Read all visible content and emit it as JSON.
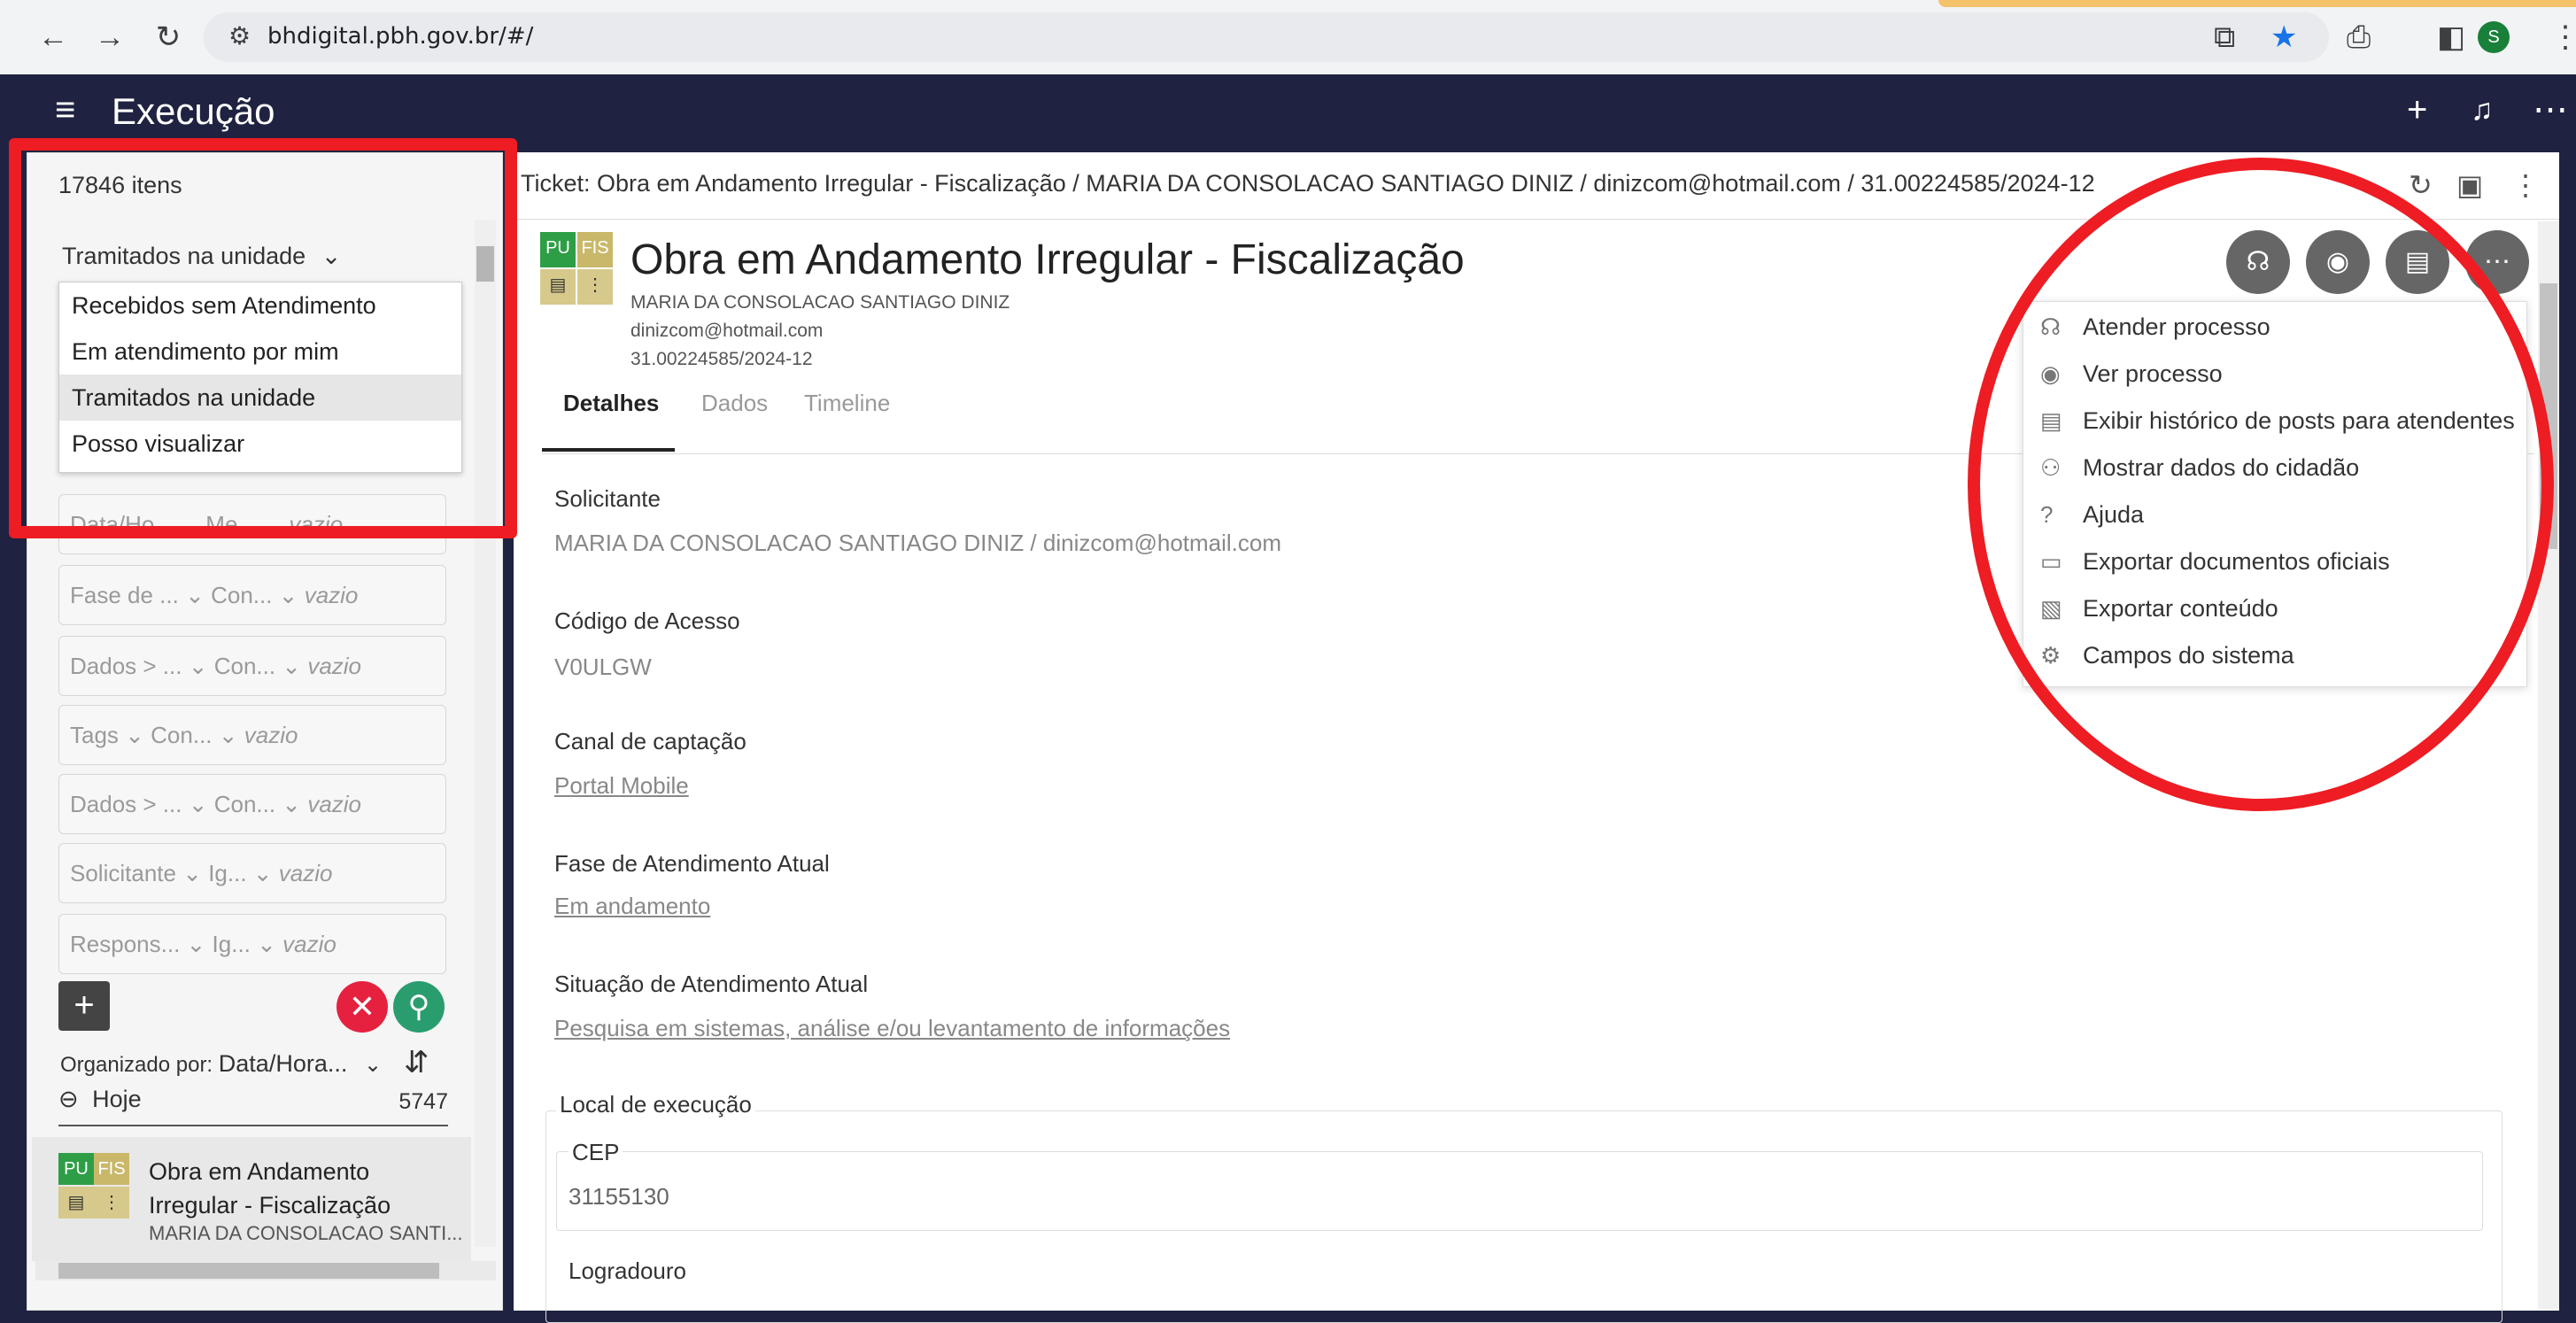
{
  "browser": {
    "url": "bhdigital.pbh.gov.br/#/",
    "profile_initial": "S"
  },
  "app": {
    "title": "Execução"
  },
  "left": {
    "items_count": "17846 itens",
    "filter_selected": "Tramitados na unidade",
    "dropdown_options": [
      "Recebidos sem Atendimento",
      "Em atendimento por mim",
      "Tramitados na unidade",
      "Posso visualizar"
    ],
    "filter_rows": [
      {
        "field": "Data/Ho...",
        "op": "Me...",
        "value": "vazio"
      },
      {
        "field": "Fase de ...",
        "op": "Con...",
        "value": "vazio"
      },
      {
        "field": "Dados > ...",
        "op": "Con...",
        "value": "vazio"
      },
      {
        "field": "Tags",
        "op": "Con...",
        "value": "vazio"
      },
      {
        "field": "Dados > ...",
        "op": "Con...",
        "value": "vazio"
      },
      {
        "field": "Solicitante",
        "op": "Ig...",
        "value": "vazio"
      },
      {
        "field": "Respons...",
        "op": "Ig...",
        "value": "vazio"
      }
    ],
    "org_label": "Organizado por:",
    "org_value": "Data/Hora...",
    "group_name": "Hoje",
    "group_count": "5747",
    "card": {
      "badge1": "PU",
      "badge2": "FIS",
      "title": "Obra em Andamento Irregular - Fiscalização",
      "subtitle": "MARIA DA CONSOLACAO SANTI..."
    }
  },
  "ticket": {
    "breadcrumb": "Ticket: Obra em Andamento Irregular - Fiscalização / MARIA DA CONSOLACAO SANTIAGO DINIZ / dinizcom@hotmail.com / 31.00224585/2024-12",
    "title": "Obra em Andamento Irregular - Fiscalização",
    "requester": "MARIA DA CONSOLACAO SANTIAGO DINIZ",
    "email": "dinizcom@hotmail.com",
    "protocol": "31.00224585/2024-12",
    "badge1": "PU",
    "badge2": "FIS"
  },
  "tabs": [
    "Detalhes",
    "Dados",
    "Timeline"
  ],
  "details": {
    "solicitante_label": "Solicitante",
    "solicitante_value": "MARIA DA CONSOLACAO SANTIAGO DINIZ / dinizcom@hotmail.com",
    "codigo_label": "Código de Acesso",
    "codigo_value": "V0ULGW",
    "canal_label": "Canal de captação",
    "canal_value": "Portal Mobile",
    "fase_label": "Fase de Atendimento Atual",
    "fase_value": "Em andamento",
    "situacao_label": "Situação de Atendimento Atual",
    "situacao_value": "Pesquisa em sistemas, análise e/ou levantamento de informações",
    "local_label": "Local de execução",
    "cep_label": "CEP",
    "cep_value": "31155130",
    "logradouro_label": "Logradouro"
  },
  "menu": [
    {
      "icon": "headset-icon",
      "glyph": "☊",
      "label": "Atender processo"
    },
    {
      "icon": "eye-icon",
      "glyph": "◉",
      "label": "Ver processo"
    },
    {
      "icon": "history-icon",
      "glyph": "▤",
      "label": "Exibir histórico de posts para atendentes"
    },
    {
      "icon": "user-icon",
      "glyph": "⚇",
      "label": "Mostrar dados do cidadão"
    },
    {
      "icon": "help-icon",
      "glyph": "?",
      "label": "Ajuda"
    },
    {
      "icon": "folder-icon",
      "glyph": "▭",
      "label": "Exportar documentos oficiais"
    },
    {
      "icon": "export-icon",
      "glyph": "▧",
      "label": "Exportar conteúdo"
    },
    {
      "icon": "gears-icon",
      "glyph": "⚙",
      "label": "Campos do sistema"
    }
  ],
  "colors": {
    "header": "#1f2240",
    "annotation": "#ee1c23",
    "badge_pu": "#2e9e46",
    "badge_fis": "#c9b86a"
  }
}
